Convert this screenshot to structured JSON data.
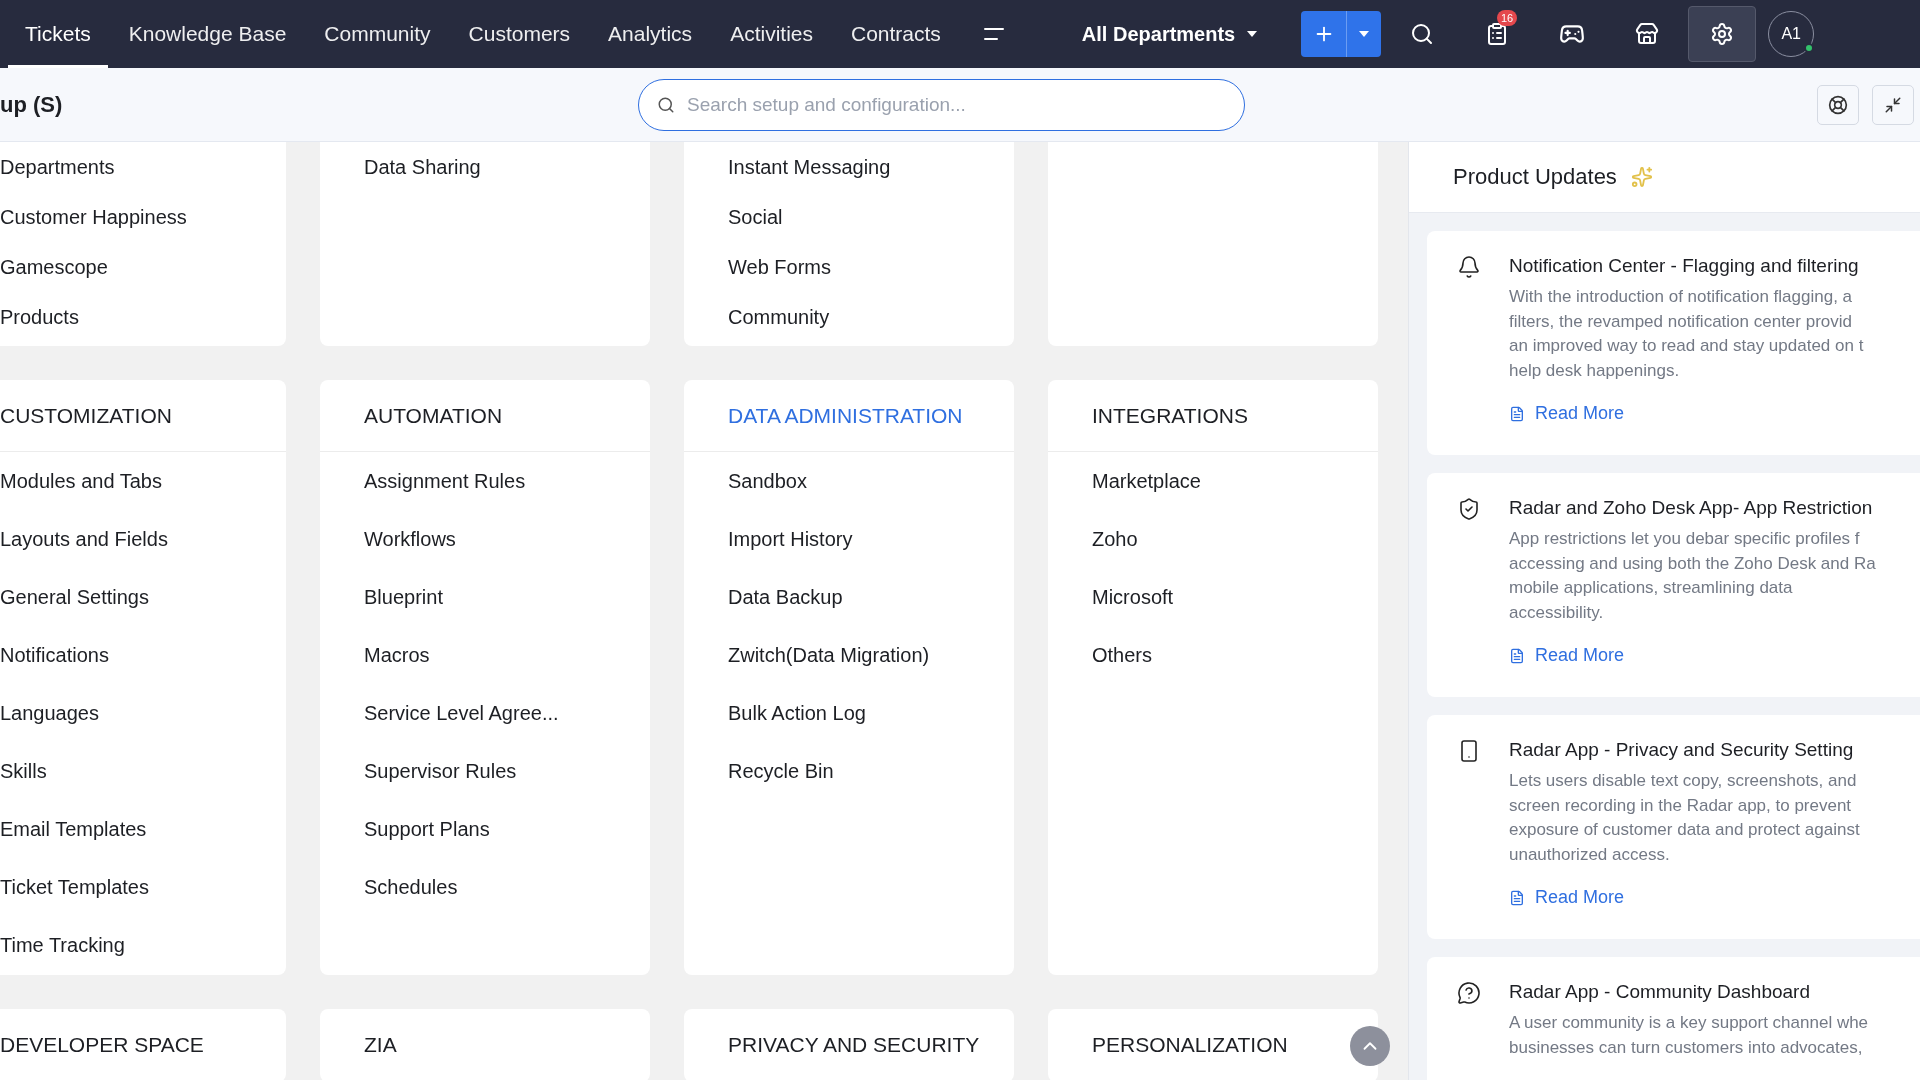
{
  "nav": {
    "tabs": [
      {
        "label": "Tickets",
        "selected": true
      },
      {
        "label": "Knowledge Base",
        "selected": false
      },
      {
        "label": "Community",
        "selected": false
      },
      {
        "label": "Customers",
        "selected": false
      },
      {
        "label": "Analytics",
        "selected": false
      },
      {
        "label": "Activities",
        "selected": false
      },
      {
        "label": "Contracts",
        "selected": false
      }
    ],
    "department": "All Departments",
    "notification_count": "16",
    "avatar": "A1"
  },
  "subheader": {
    "title": "up (S)",
    "search": {
      "placeholder": "Search setup and configuration..."
    }
  },
  "setup_rows": [
    [
      {
        "items": [
          "Departments",
          "Customer Happiness",
          "Gamescope",
          "Products"
        ]
      },
      {
        "items": [
          "Data Sharing"
        ]
      },
      {
        "items": [
          "Instant Messaging",
          "Social",
          "Web Forms",
          "Community"
        ]
      },
      {}
    ],
    [
      {
        "heading": "CUSTOMIZATION",
        "highlighted": false,
        "items": [
          "Modules and Tabs",
          "Layouts and Fields",
          "General Settings",
          "Notifications",
          "Languages",
          "Skills",
          "Email Templates",
          "Ticket Templates",
          "Time Tracking"
        ]
      },
      {
        "heading": "AUTOMATION",
        "highlighted": false,
        "items": [
          "Assignment Rules",
          "Workflows",
          "Blueprint",
          "Macros",
          "Service Level Agree...",
          "Supervisor Rules",
          "Support Plans",
          "Schedules"
        ]
      },
      {
        "heading": "DATA ADMINISTRATION",
        "highlighted": true,
        "items": [
          "Sandbox",
          "Import History",
          "Data Backup",
          "Zwitch(Data Migration)",
          "Bulk Action Log",
          "Recycle Bin"
        ]
      },
      {
        "heading": "INTEGRATIONS",
        "highlighted": false,
        "items": [
          "Marketplace",
          "Zoho",
          "Microsoft",
          "Others"
        ]
      }
    ],
    [
      {
        "heading": "DEVELOPER SPACE",
        "highlighted": false
      },
      {
        "heading": "ZIA",
        "highlighted": false
      },
      {
        "heading": "PRIVACY AND SECURITY",
        "highlighted": false
      },
      {
        "heading": "PERSONALIZATION",
        "highlighted": false
      }
    ]
  ],
  "product_updates": {
    "title": "Product Updates",
    "updates": [
      {
        "kind": "bell",
        "title": "Notification Center - Flagging and filtering",
        "lines": [
          "With the introduction of notification flagging, a",
          "filters, the revamped notification center provid",
          "an improved way to read and stay updated on t",
          "help desk happenings."
        ],
        "link": "Read More"
      },
      {
        "kind": "shield",
        "title": "Radar and Zoho Desk App- App Restriction",
        "lines": [
          "App restrictions let you debar specific profiles f",
          "accessing and using both the Zoho Desk and Ra",
          "mobile applications, streamlining data",
          "accessibility."
        ],
        "link": "Read More"
      },
      {
        "kind": "phone",
        "title": "Radar App - Privacy and Security Setting",
        "lines": [
          "Lets users disable text copy, screenshots, and",
          "screen recording in the Radar app, to prevent",
          "exposure of customer data and protect against",
          "unauthorized access."
        ],
        "link": "Read More"
      },
      {
        "kind": "community",
        "title": "Radar App - Community Dashboard",
        "lines": [
          "A user community is a key support channel whe",
          "businesses can turn customers into advocates,"
        ]
      }
    ]
  }
}
